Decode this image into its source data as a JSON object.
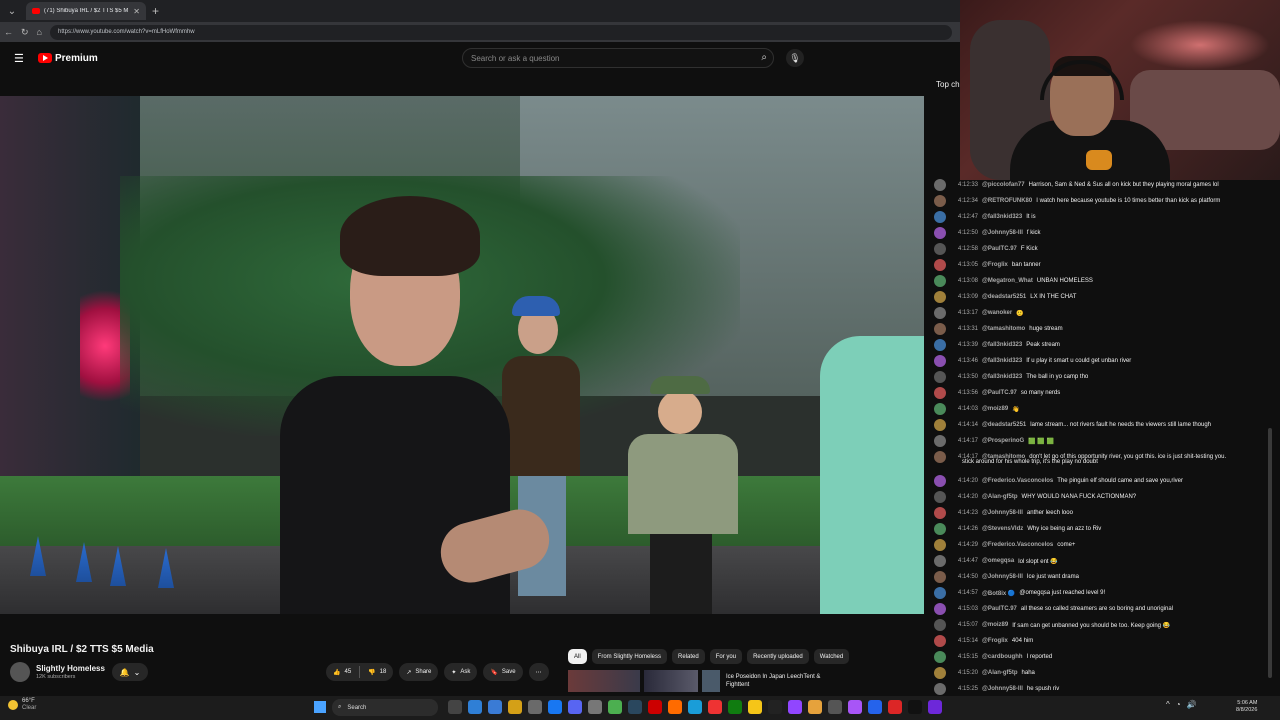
{
  "browser": {
    "tab_title": "(71) Shibuya IRL / $2 TTS $5 M",
    "url": "https://www.youtube.com/watch?v=mLfHoWfmmhw"
  },
  "header": {
    "logo_text": "Premium",
    "search_placeholder": "Search or ask a question"
  },
  "video": {
    "title": "Shibuya IRL / $2 TTS $5 Media",
    "channel_name": "Slightly Homeless",
    "subscribers": "12K subscribers",
    "likes": "45",
    "dislikes": "18",
    "share_label": "Share",
    "ask_label": "Ask",
    "save_label": "Save"
  },
  "chips": [
    "All",
    "From Slightly Homeless",
    "Related",
    "For you",
    "Recently uploaded",
    "Watched"
  ],
  "recommendation": {
    "title_line1": "Ice Poseidon In Japan LeechTent &",
    "title_line2": "Fighttent"
  },
  "chat": {
    "header": "Top ch",
    "messages": [
      {
        "time": "4:12:33",
        "author": "@piccolofan77",
        "text": "Harrison, Sam & Ned & Sus all on kick but they playing moral games lol"
      },
      {
        "time": "4:12:34",
        "author": "@RETROFUNK80",
        "text": "I watch here because youtube is 10 times better than kick as platform"
      },
      {
        "time": "4:12:47",
        "author": "@fall3nkid323",
        "text": "It is"
      },
      {
        "time": "4:12:50",
        "author": "@Johnny58-lll",
        "text": "f kick"
      },
      {
        "time": "4:12:58",
        "author": "@PaulTC.97",
        "text": "F Kick"
      },
      {
        "time": "4:13:05",
        "author": "@Froglix",
        "text": "ban tanner"
      },
      {
        "time": "4:13:08",
        "author": "@Megatron_What",
        "text": "UNBAN HOMELESS"
      },
      {
        "time": "4:13:09",
        "author": "@deadstar5251",
        "text": "LX IN THE CHAT"
      },
      {
        "time": "4:13:17",
        "author": "@wanoker",
        "text": "🙂"
      },
      {
        "time": "4:13:31",
        "author": "@tamashitomo",
        "text": "huge stream"
      },
      {
        "time": "4:13:39",
        "author": "@fall3nkid323",
        "text": "Peak stream"
      },
      {
        "time": "4:13:46",
        "author": "@fall3nkid323",
        "text": "If u play it smart u could get unban river"
      },
      {
        "time": "4:13:50",
        "author": "@fall3nkid323",
        "text": "The ball in yo camp tho"
      },
      {
        "time": "4:13:56",
        "author": "@PaulTC.97",
        "text": "so many nerds"
      },
      {
        "time": "4:14:03",
        "author": "@moiz89",
        "text": "👋"
      },
      {
        "time": "4:14:14",
        "author": "@deadstar5251",
        "text": "lame stream... not rivers fault he needs the viewers still lame though"
      },
      {
        "time": "4:14:17",
        "author": "@ProsperinoG",
        "text": "🟩 🟩 🟩"
      },
      {
        "time": "4:14:17",
        "author": "@tamashitomo",
        "text": "don't let go of this opportunity river, you got this. ice is just shit-testing you."
      },
      {
        "time": "",
        "author": "",
        "text": "stick around for his whole trip, it's the play no doubt"
      },
      {
        "time": "4:14:20",
        "author": "@Frederico.Vasconcelos",
        "text": "The pinguin elf should came and save you,river"
      },
      {
        "time": "4:14:20",
        "author": "@Alan-gf5tp",
        "text": "WHY WOULD NANA FUCK ACTIONMAN?"
      },
      {
        "time": "4:14:23",
        "author": "@Johnny58-lll",
        "text": "anther leech looo"
      },
      {
        "time": "4:14:26",
        "author": "@StevensVldz",
        "text": "Why ice being an azz to Riv"
      },
      {
        "time": "4:14:29",
        "author": "@Frederico.Vasconcelos",
        "text": "come+"
      },
      {
        "time": "4:14:47",
        "author": "@omegqsa",
        "text": "lol slopt ent 😂"
      },
      {
        "time": "4:14:50",
        "author": "@Johnny58-lll",
        "text": "Ice just want drama"
      },
      {
        "time": "4:14:57",
        "author": "@Bot8ix 🔵",
        "text": "@omegqsa just reached level 9!"
      },
      {
        "time": "4:15:03",
        "author": "@PaulTC.97",
        "text": "all these so called streamers are so boring and unoriginal"
      },
      {
        "time": "4:15:07",
        "author": "@moiz89",
        "text": "If sam can get unbanned you should be too. Keep going 😂"
      },
      {
        "time": "4:15:14",
        "author": "@Froglix",
        "text": "404 him"
      },
      {
        "time": "4:15:15",
        "author": "@cardboughh",
        "text": "I reported"
      },
      {
        "time": "4:15:20",
        "author": "@Alan-gf5tp",
        "text": "haha"
      },
      {
        "time": "4:15:25",
        "author": "@Johnny58-lll",
        "text": "he spush riv"
      }
    ]
  },
  "taskbar": {
    "temp": "66°F",
    "condition": "Clear",
    "search_label": "Search",
    "time": "5:06 AM",
    "date": "8/8/2026"
  },
  "colors": {
    "accent": "#ff0000",
    "background": "#0f0f0f",
    "pill": "#272727"
  }
}
